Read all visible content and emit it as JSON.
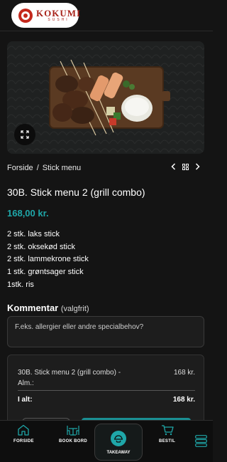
{
  "brand": {
    "name": "KOKUMI",
    "sub": "SUSHI"
  },
  "breadcrumb": {
    "home": "Forside",
    "separator": "/",
    "current": "Stick menu"
  },
  "product": {
    "title": "30B. Stick menu 2 (grill combo)",
    "price": "168,00 kr.",
    "contents": [
      "2 stk. laks stick",
      "2 stk. oksekød stick",
      "2 stk. lammekrone stick",
      "1 stk. grøntsager stick",
      "1stk. ris"
    ]
  },
  "comment": {
    "label": "Kommentar",
    "optional": "(valgfrit)",
    "placeholder": "F.eks. allergier eller andre specialbehov?"
  },
  "summary": {
    "item_name": "30B. Stick menu 2 (grill combo) -",
    "item_variant": "Alm.:",
    "item_amount": "168 kr.",
    "total_label": "I alt:",
    "total_amount": "168 kr."
  },
  "bottom_nav": {
    "items": [
      {
        "label": "FORSIDE",
        "icon": "home-icon"
      },
      {
        "label": "BOOK BORD",
        "icon": "table-icon"
      },
      {
        "label": "TAKEAWAY",
        "icon": "takeaway-icon"
      },
      {
        "label": "BESTIL",
        "icon": "basket-icon"
      }
    ],
    "menu_icon": "hamburger-menu-icon"
  },
  "colors": {
    "accent": "#1fa7a9",
    "background": "#141414",
    "brand_red": "#c4281c"
  }
}
